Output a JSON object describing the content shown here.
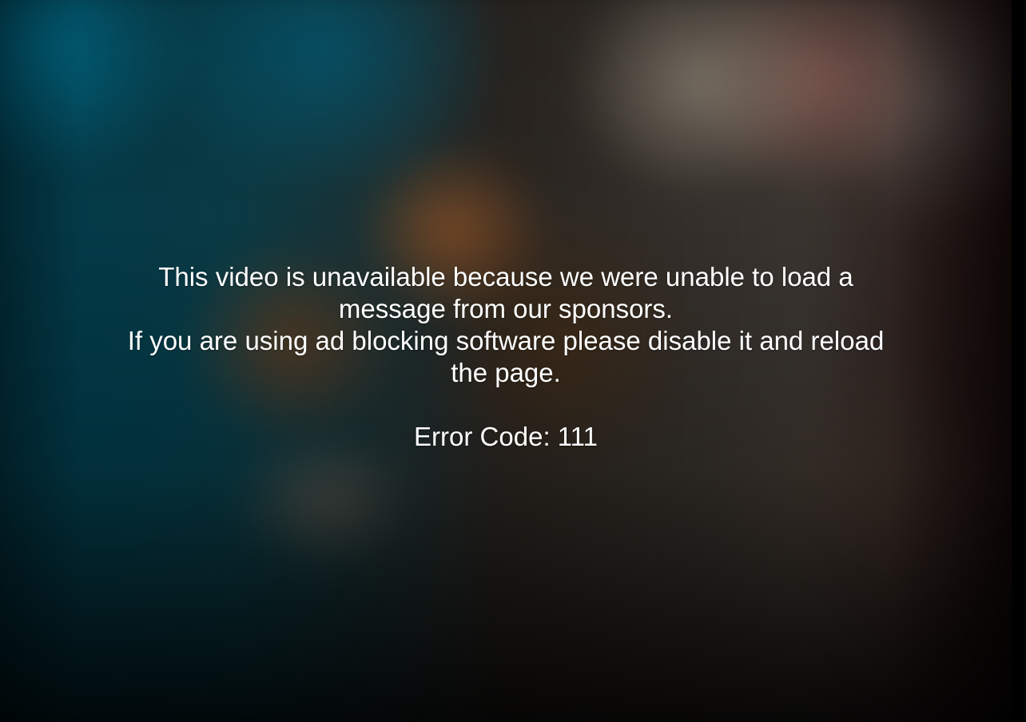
{
  "player": {
    "error": {
      "line1": "This video is unavailable because we were unable to load a message from our sponsors.",
      "line2": "If you are using ad blocking software please disable it and reload the page.",
      "code": "Error Code: 111"
    }
  },
  "colors": {
    "text": "#ffffff",
    "background": "#000000"
  }
}
